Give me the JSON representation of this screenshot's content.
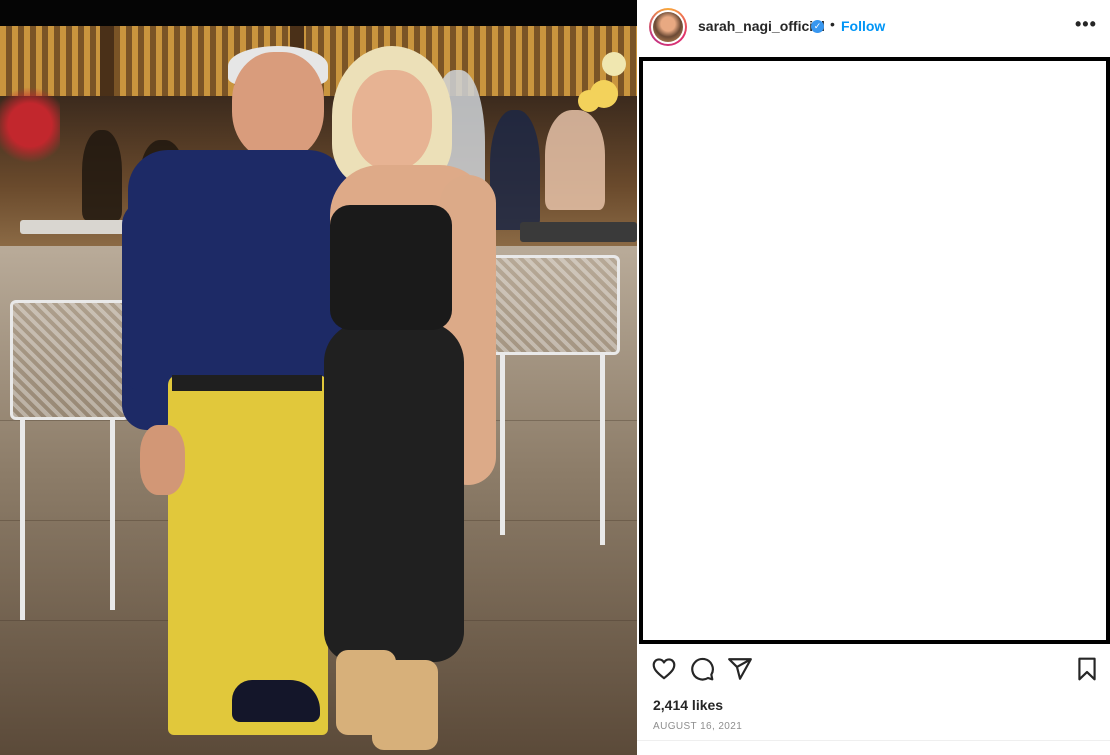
{
  "post": {
    "username": "sarah_nagi_official",
    "verified_badge": "✓",
    "separator": "•",
    "follow_label": "Follow",
    "more_label": "•••",
    "likes": "2,414 likes",
    "date": "AUGUST 16, 2021"
  },
  "icons": {
    "like": "heart-icon",
    "comment": "comment-icon",
    "share": "share-icon",
    "save": "bookmark-icon",
    "more": "more-options-icon",
    "verified": "verified-badge-icon"
  },
  "colors": {
    "accent": "#0095f6",
    "verified": "#3897f0",
    "text": "#262626",
    "muted": "#8e8e8e"
  }
}
